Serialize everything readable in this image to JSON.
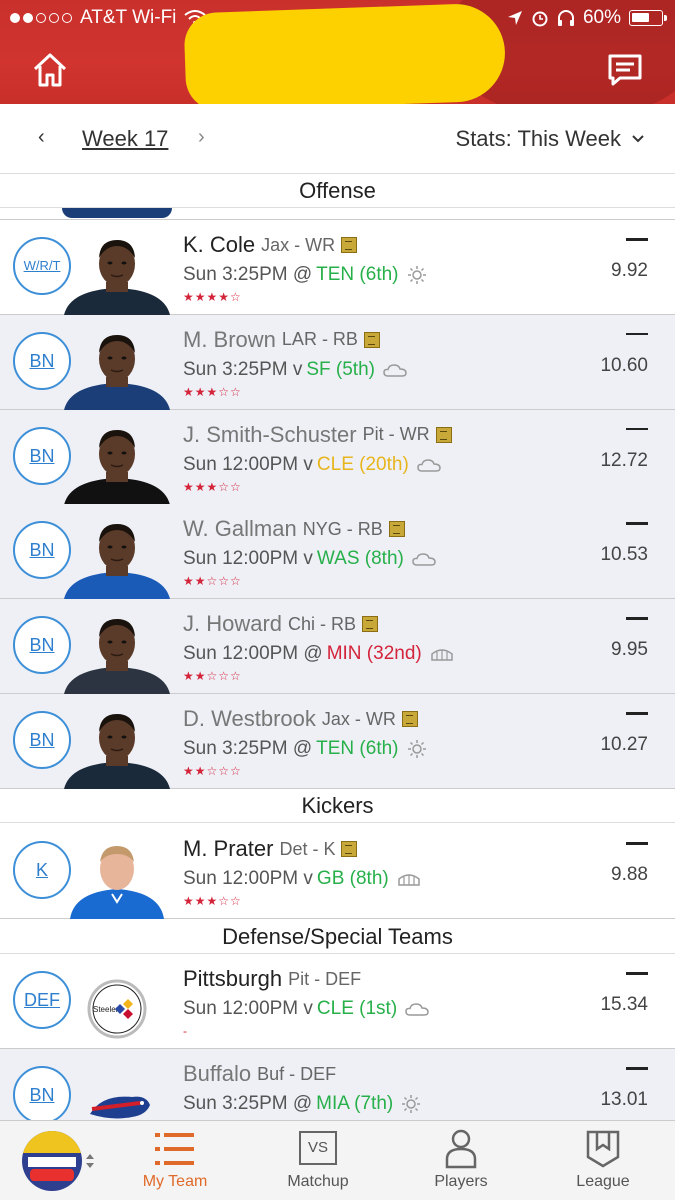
{
  "status_bar": {
    "carrier": "AT&T Wi-Fi",
    "battery": "60%",
    "battery_fraction": 0.6
  },
  "week_nav": {
    "prev": "‹",
    "week_label": "Week 17",
    "next": "›",
    "stats_label": "Stats: This Week",
    "stats_caret": "⌄"
  },
  "sections": {
    "offense": "Offense",
    "kickers": "Kickers",
    "defense": "Defense/Special Teams"
  },
  "players": [
    {
      "slot": "W/R/T",
      "name": "K. Cole",
      "team_pos": "Jax - WR",
      "game_prefix": "Sun 3:25PM @",
      "opponent": "TEN (6th)",
      "opp_color": "green",
      "weather": "sun",
      "stars": "★★★★☆",
      "proj": "9.92"
    },
    {
      "slot": "BN",
      "name": "M. Brown",
      "team_pos": "LAR - RB",
      "game_prefix": "Sun 3:25PM v ",
      "opponent": "SF (5th)",
      "opp_color": "green",
      "weather": "cloud",
      "stars": "★★★☆☆",
      "proj": "10.60"
    },
    {
      "slot": "BN",
      "name": "J. Smith-Schuster",
      "team_pos": "Pit - WR",
      "game_prefix": "Sun 12:00PM v ",
      "opponent": "CLE (20th)",
      "opp_color": "yellow",
      "weather": "cloud",
      "stars": "★★★☆☆",
      "proj": "12.72"
    },
    {
      "slot": "BN",
      "name": "W. Gallman",
      "team_pos": "NYG - RB",
      "game_prefix": "Sun 12:00PM v ",
      "opponent": "WAS (8th)",
      "opp_color": "green",
      "weather": "cloud",
      "stars": "★★☆☆☆",
      "proj": "10.53"
    },
    {
      "slot": "BN",
      "name": "J. Howard",
      "team_pos": "Chi - RB",
      "game_prefix": "Sun 12:00PM @",
      "opponent": "MIN (32nd)",
      "opp_color": "red",
      "weather": "dome",
      "stars": "★★☆☆☆",
      "proj": "9.95"
    },
    {
      "slot": "BN",
      "name": "D. Westbrook",
      "team_pos": "Jax - WR",
      "game_prefix": "Sun 3:25PM @",
      "opponent": "TEN (6th)",
      "opp_color": "green",
      "weather": "sun",
      "stars": "★★☆☆☆",
      "proj": "10.27"
    }
  ],
  "kicker": {
    "slot": "K",
    "name": "M. Prater",
    "team_pos": "Det - K",
    "game_prefix": "Sun 12:00PM v ",
    "opponent": "GB (8th)",
    "opp_color": "green",
    "weather": "dome",
    "stars": "★★★☆☆",
    "proj": "9.88"
  },
  "defenses": [
    {
      "slot": "DEF",
      "name": "Pittsburgh",
      "team_pos": "Pit - DEF",
      "game_prefix": "Sun 12:00PM v ",
      "opponent": "CLE (1st)",
      "opp_color": "green",
      "weather": "cloud",
      "stars": "-",
      "proj": "15.34",
      "logo_text": "Steelers"
    },
    {
      "slot": "BN",
      "name": "Buffalo",
      "team_pos": "Buf - DEF",
      "game_prefix": "Sun 3:25PM @",
      "opponent": "MIA (7th)",
      "opp_color": "green",
      "weather": "sun",
      "stars": "",
      "proj": "13.01"
    }
  ],
  "tabs": {
    "my_team": "My Team",
    "matchup": "Matchup",
    "matchup_icon_text": "VS",
    "players": "Players",
    "league": "League"
  },
  "colors": {
    "accent": "#e06a2a",
    "header_red": "#c9302c",
    "slot_blue": "#3d8fd8",
    "green": "#27b04a",
    "yellow": "#e8b51c",
    "red": "#d4243a"
  }
}
